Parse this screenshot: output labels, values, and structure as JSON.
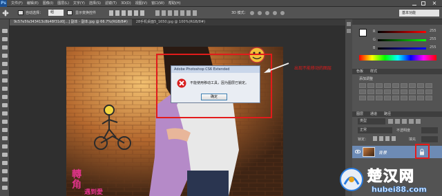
{
  "app": {
    "logo": "Ps"
  },
  "menu": [
    "文件(F)",
    "编辑(E)",
    "图像(I)",
    "图层(L)",
    "文字(Y)",
    "选择(S)",
    "滤镜(T)",
    "3D(D)",
    "视图(V)",
    "窗口(W)",
    "帮助(H)"
  ],
  "options": {
    "auto_select_label": "自动选择：",
    "auto_select_value": "组",
    "show_transform_label": "显示变换控件",
    "mode_3d_label": "3D 模式：",
    "workspace_label": "基本功能"
  },
  "tabs": [
    {
      "label": "9c57e5fa343413c8b48f31d0[...] 副本 - 副本.jpg @ 66.7%(RGB/8#)",
      "active": true
    },
    {
      "label": "28手机桌面5_1650.jpg @ 100%(RGB/8#)",
      "active": false
    }
  ],
  "dialog": {
    "title": "Adobe Photoshop CS6 Extended",
    "message": "不能使用移动工具，因为图层已锁定。",
    "ok_label": "确定"
  },
  "annotation": {
    "text": "出现不能移动的图层"
  },
  "color_panel": {
    "labels": [
      "R",
      "G",
      "B"
    ],
    "values": [
      "255",
      "255",
      "255"
    ]
  },
  "swatch_panel": {
    "tabs": [
      "色板",
      "样式"
    ],
    "title": "添加调整"
  },
  "layers_panel": {
    "tabs": [
      "图层",
      "通道",
      "路径"
    ],
    "kind_label": "类型",
    "blend_mode": "正常",
    "opacity_label": "不透明度",
    "lock_label": "锁定：",
    "fill_label": "填充",
    "layer_name": "背景"
  },
  "canvas_text": {
    "line1": "轉",
    "line2": "角",
    "line3": "遇到愛"
  },
  "watermark": {
    "cn": "楚汉网",
    "en": "hubei88.com"
  },
  "colors": {
    "accent_red": "#e31b1b",
    "ps_blue": "#1b4f91",
    "dialog_bg": "#e9edf3",
    "watermark_blue": "#2a7de1",
    "layer_selected": "#6d8bb5"
  }
}
